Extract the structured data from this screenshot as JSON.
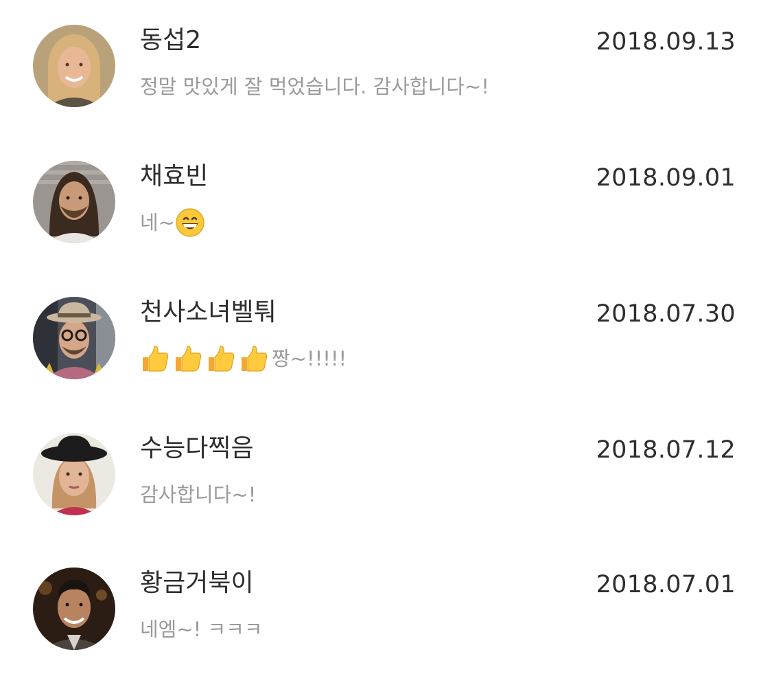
{
  "messages": [
    {
      "name": "동섭2",
      "date": "2018.09.13",
      "text": "정말 맛있게 잘 먹었습니다. 감사합니다~!",
      "avatar_icon": "avatar-woman-blonde",
      "avatar_colors": {
        "bg": "#b9a27a",
        "skin": "#e8b896",
        "hair": "#d8b27a",
        "cloth": "#5b5345"
      }
    },
    {
      "name": "채효빈",
      "date": "2018.09.01",
      "text": "네~",
      "emoji": "grinning-face",
      "avatar_icon": "avatar-man-dreadlocks",
      "avatar_colors": {
        "bg": "#9a9590",
        "skin": "#c89a78",
        "hair": "#3b2a1e",
        "cloth": "#e9e6e1"
      }
    },
    {
      "name": "천사소녀벨퉈",
      "date": "2018.07.30",
      "text": "짱~!!!!!",
      "emoji": "thumbs-up",
      "emoji_count": 4,
      "avatar_icon": "avatar-man-hat-glasses",
      "avatar_colors": {
        "bg": "#4a4e58",
        "skin": "#d6a688",
        "hair": "#c9b89f",
        "cloth": "#b56a82"
      }
    },
    {
      "name": "수능다찍음",
      "date": "2018.07.12",
      "text": "감사합니다~!",
      "avatar_icon": "avatar-woman-black-hat",
      "avatar_colors": {
        "bg": "#ece9e3",
        "skin": "#e1b596",
        "hair": "#c49467",
        "cloth": "#c0304f"
      }
    },
    {
      "name": "황금거북이",
      "date": "2018.07.01",
      "text": "네엠~! ㅋㅋㅋ",
      "avatar_icon": "avatar-man-suit",
      "avatar_colors": {
        "bg": "#2b1d14",
        "skin": "#b8845f",
        "hair": "#1a1410",
        "cloth": "#4a4340"
      }
    }
  ]
}
